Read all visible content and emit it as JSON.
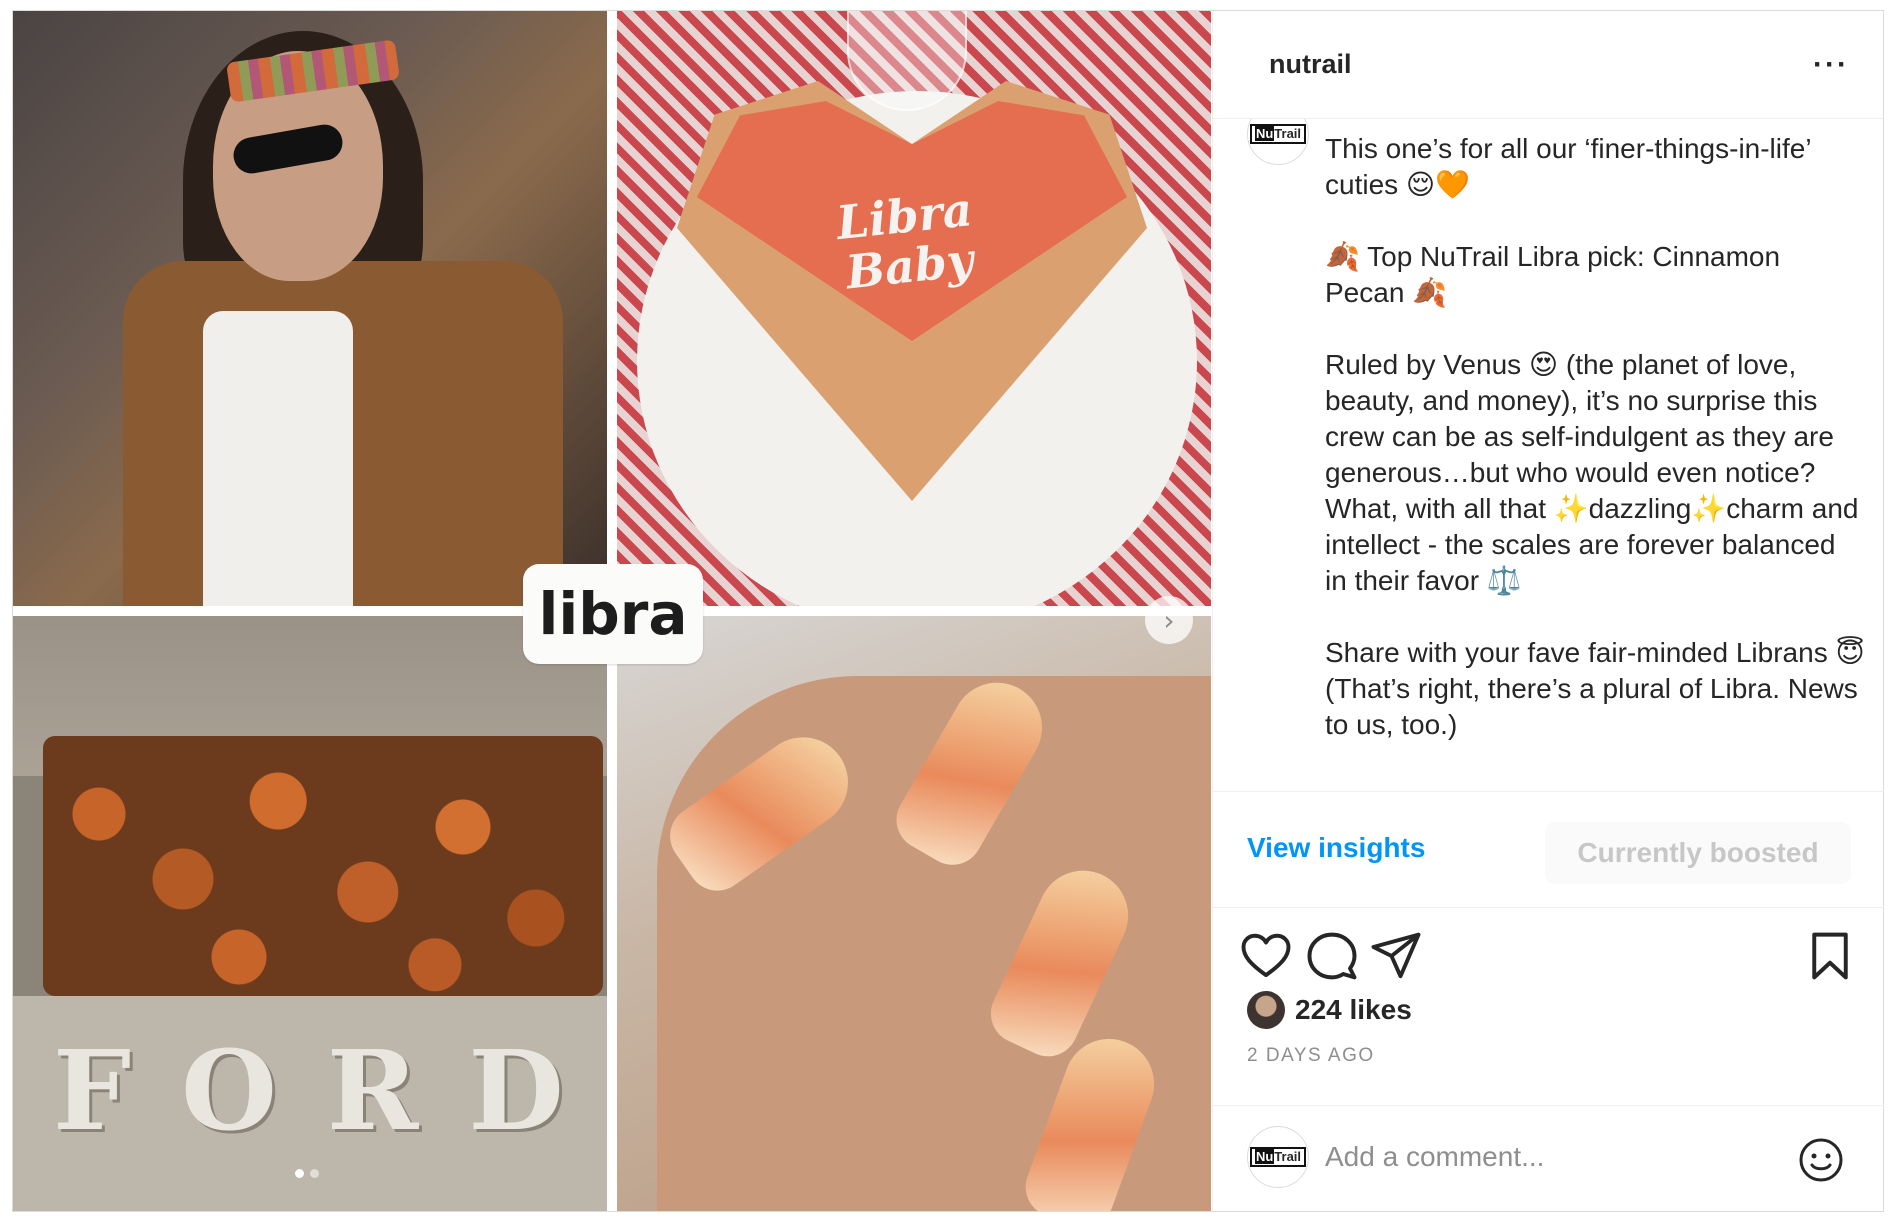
{
  "media": {
    "badge_text": "libra",
    "cake_text": "Libra Baby",
    "truck_text": "FORD",
    "next_icon": "chevron-right-icon",
    "carousel_dots": 2
  },
  "header": {
    "username": "nutrail",
    "more_icon": "more-horizontal-icon"
  },
  "caption": {
    "avatar_label": "NuTrail",
    "text": "This one’s for all our ‘finer-things-in-life’ cuties 😌🧡\n\n🍂 Top NuTrail Libra pick: Cinnamon Pecan 🍂\n\nRuled by Venus 😍 (the planet of love, beauty, and money), it’s no surprise this crew can be as self-indulgent as they are generous…but who would even notice? What, with all that ✨dazzling✨charm and intellect - the scales are forever balanced in their favor ⚖️\n\nShare with your fave fair-minded Librans 😇 (That’s right, there’s a plural of Libra. News to us, too.)"
  },
  "insights": {
    "view_label": "View insights",
    "boosted_label": "Currently boosted"
  },
  "actions": {
    "like_icon": "heart-icon",
    "comment_icon": "comment-icon",
    "share_icon": "send-icon",
    "save_icon": "bookmark-icon"
  },
  "likes": {
    "count_label": "224 likes"
  },
  "timestamp": "2 DAYS AGO",
  "comment": {
    "avatar_label": "NuTrail",
    "placeholder": "Add a comment...",
    "emoji_icon": "smiley-icon"
  },
  "colors": {
    "link": "#0095f6",
    "muted": "#8e8e8e",
    "text": "#262626"
  }
}
